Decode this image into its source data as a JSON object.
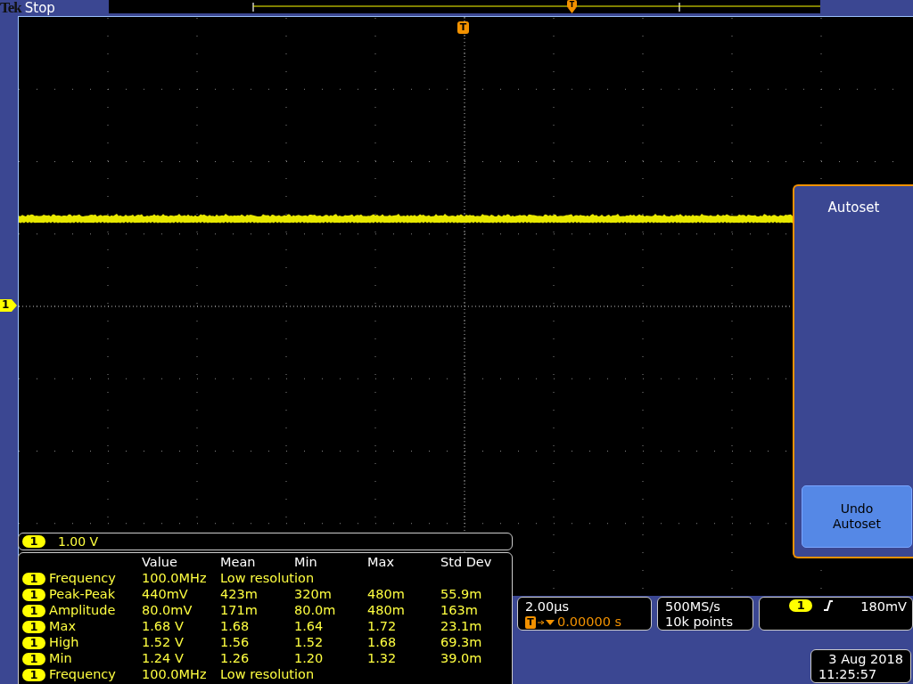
{
  "header": {
    "brand": "Tek",
    "status": "Stop"
  },
  "markers": {
    "record_trigger": "T",
    "trigger_position": "T",
    "channel": "1"
  },
  "channel_readout": {
    "channel": "1",
    "scale": "1.00 V"
  },
  "measurements": {
    "columns": [
      "Value",
      "Mean",
      "Min",
      "Max",
      "Std Dev"
    ],
    "rows": [
      {
        "channel": "1",
        "name": "Frequency",
        "value": "100.0MHz",
        "note": "Low resolution"
      },
      {
        "channel": "1",
        "name": "Peak-Peak",
        "value": "440mV",
        "mean": "423m",
        "min": "320m",
        "max": "480m",
        "std_dev": "55.9m"
      },
      {
        "channel": "1",
        "name": "Amplitude",
        "value": "80.0mV",
        "mean": "171m",
        "min": "80.0m",
        "max": "480m",
        "std_dev": "163m"
      },
      {
        "channel": "1",
        "name": "Max",
        "value": "1.68 V",
        "mean": "1.68",
        "min": "1.64",
        "max": "1.72",
        "std_dev": "23.1m"
      },
      {
        "channel": "1",
        "name": "High",
        "value": "1.52 V",
        "mean": "1.56",
        "min": "1.52",
        "max": "1.68",
        "std_dev": "69.3m"
      },
      {
        "channel": "1",
        "name": "Min",
        "value": "1.24 V",
        "mean": "1.26",
        "min": "1.20",
        "max": "1.32",
        "std_dev": "39.0m"
      },
      {
        "channel": "1",
        "name": "Frequency",
        "value": "100.0MHz",
        "note": "Low resolution"
      }
    ]
  },
  "horizontal": {
    "scale": "2.00µs",
    "trigger_icon": "T",
    "position": "0.00000 s"
  },
  "acquisition": {
    "rate": "500MS/s",
    "points": "10k points"
  },
  "trigger": {
    "channel": "1",
    "level": "180mV"
  },
  "side_menu": {
    "title": "Autoset",
    "buttons": [
      "Undo Autoset"
    ]
  },
  "datetime": {
    "date": "3 Aug 2018",
    "time": "11:25:57"
  }
}
